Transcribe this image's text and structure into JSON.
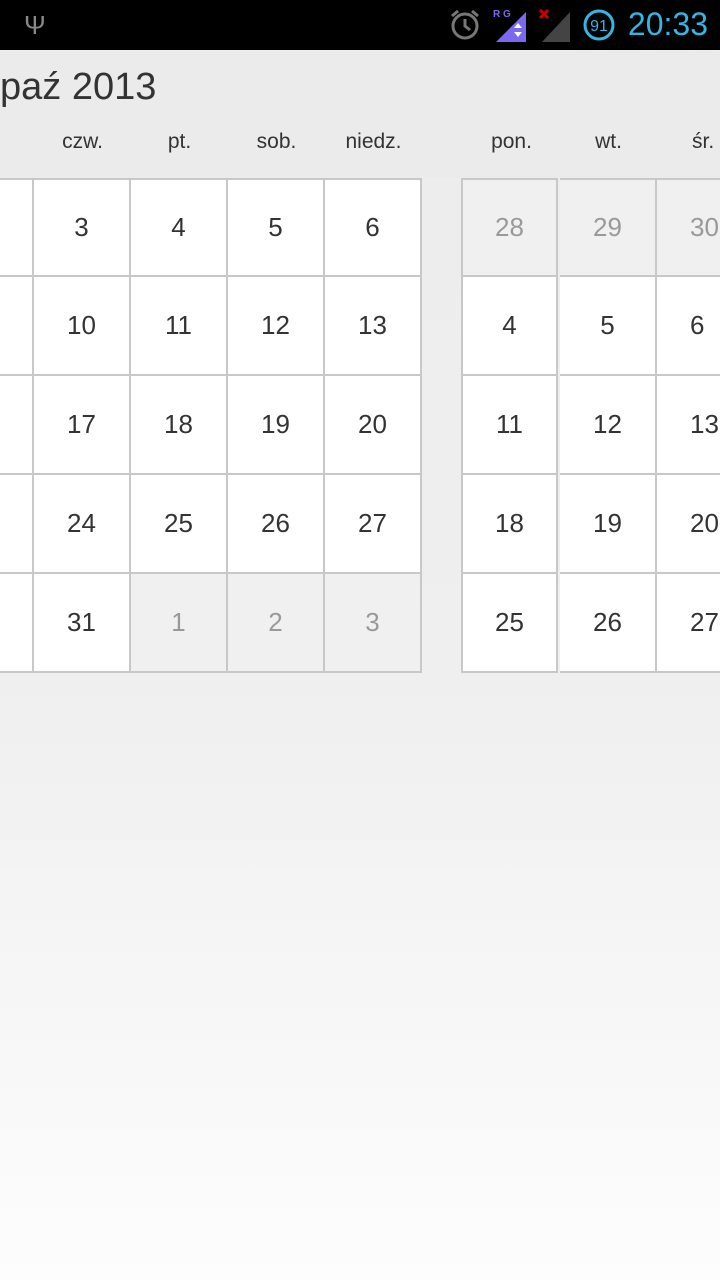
{
  "status_bar": {
    "time": "20:33",
    "battery": "91",
    "network_labels": "R G",
    "icons": [
      "usb-icon",
      "alarm-icon",
      "signal-icon",
      "no-signal-icon",
      "battery-icon"
    ],
    "accent": "#33b5e5"
  },
  "month1": {
    "title": "paź 2013",
    "weekdays": [
      "czw.",
      "pt.",
      "sob.",
      "niedz."
    ],
    "rows": [
      [
        {
          "d": "3"
        },
        {
          "d": "4"
        },
        {
          "d": "5"
        },
        {
          "d": "6"
        }
      ],
      [
        {
          "d": "10"
        },
        {
          "d": "11"
        },
        {
          "d": "12"
        },
        {
          "d": "13"
        }
      ],
      [
        {
          "d": "17"
        },
        {
          "d": "18"
        },
        {
          "d": "19"
        },
        {
          "d": "20"
        }
      ],
      [
        {
          "d": "24"
        },
        {
          "d": "25"
        },
        {
          "d": "26"
        },
        {
          "d": "27"
        }
      ],
      [
        {
          "d": "31"
        },
        {
          "d": "1",
          "other": true
        },
        {
          "d": "2",
          "other": true
        },
        {
          "d": "3",
          "other": true
        }
      ]
    ]
  },
  "month2": {
    "weekdays": [
      "pon.",
      "wt.",
      "śr."
    ],
    "rows": [
      [
        {
          "d": "28",
          "other": true
        },
        {
          "d": "29",
          "other": true
        },
        {
          "d": "30",
          "other": true
        }
      ],
      [
        {
          "d": "4"
        },
        {
          "d": "5"
        },
        {
          "d": "6"
        }
      ],
      [
        {
          "d": "11"
        },
        {
          "d": "12"
        },
        {
          "d": "13"
        }
      ],
      [
        {
          "d": "18"
        },
        {
          "d": "19"
        },
        {
          "d": "20"
        }
      ],
      [
        {
          "d": "25"
        },
        {
          "d": "26"
        },
        {
          "d": "27"
        }
      ]
    ]
  }
}
